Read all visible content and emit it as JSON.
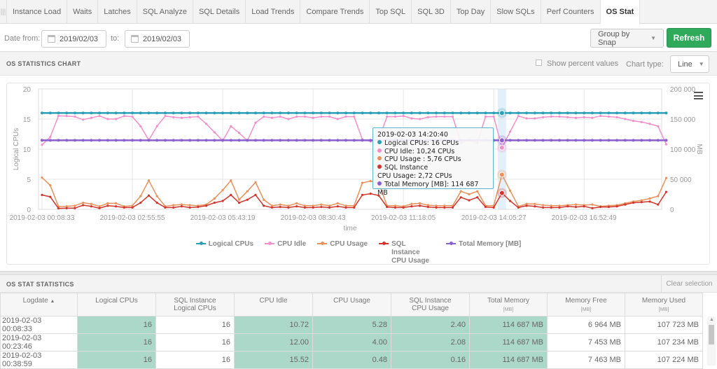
{
  "tabs": [
    {
      "label": "Instance Load",
      "active": false
    },
    {
      "label": "Waits",
      "active": false
    },
    {
      "label": "Latches",
      "active": false
    },
    {
      "label": "SQL Analyze",
      "active": false
    },
    {
      "label": "SQL Details",
      "active": false
    },
    {
      "label": "Load Trends",
      "active": false
    },
    {
      "label": "Compare Trends",
      "active": false
    },
    {
      "label": "Top SQL",
      "active": false
    },
    {
      "label": "SQL 3D",
      "active": false
    },
    {
      "label": "Top Day",
      "active": false
    },
    {
      "label": "Slow SQLs",
      "active": false
    },
    {
      "label": "Perf Counters",
      "active": false
    },
    {
      "label": "OS Stat",
      "active": true
    }
  ],
  "toolbar": {
    "date_from_label": "Date from:",
    "date_from": "2019/02/03",
    "to_label": "to:",
    "date_to": "2019/02/03",
    "group_by": "Group by Snap",
    "refresh_label": "Refresh"
  },
  "chart_panel": {
    "title": "OS STATISTICS CHART",
    "show_percent_label": "Show percent values",
    "show_percent_checked": false,
    "chart_type_label": "Chart type:",
    "chart_type": "Line",
    "menu_icon": "hamburger-menu-icon"
  },
  "tooltip": {
    "time": "2019-02-03 14:20:40",
    "lines": [
      {
        "text": "Logical CPUs: 16 CPUs",
        "color": "#2a9fb5"
      },
      {
        "text": "CPU Idle: 10,24 CPUs",
        "color": "#f28fc9"
      },
      {
        "text": "CPU Usage : 5,76 CPUs",
        "color": "#e8915a"
      },
      {
        "text": "SQL Instance",
        "color": "#d0342c"
      },
      {
        "text": "CPU Usage: 2,72 CPUs",
        "color": null
      },
      {
        "text": "Total Memory [MB]: 114 687 MB",
        "color": "#8a5fd0"
      }
    ]
  },
  "chart_data": {
    "type": "line",
    "title": "",
    "xlabel": "time",
    "ylabel": "Logical CPUs",
    "y2label": "MB",
    "ylim": [
      0,
      20
    ],
    "y2lim": [
      0,
      200000
    ],
    "yticks": [
      "0",
      "5",
      "10",
      "15",
      "20"
    ],
    "y2ticks": [
      "0",
      "50 000",
      "100 000",
      "150 000",
      "200 000"
    ],
    "xtick_labels": [
      "2019-02-03 00:08:33",
      "2019-02-03 02:55:55",
      "2019-02-03 05:43:19",
      "2019-02-03 08:30:43",
      "2019-02-03 11:18:05",
      "2019-02-03 14:05:27",
      "2019-02-03 16:52:49"
    ],
    "xtick_index": [
      0,
      11,
      22,
      33,
      44,
      55,
      66
    ],
    "highlight_index": 56,
    "grid": true,
    "legend_position": "bottom",
    "series": [
      {
        "name": "Logical CPUs",
        "color": "#2a9fb5",
        "axis": "left",
        "constant": 16
      },
      {
        "name": "CPU Idle",
        "color": "#f28fc9",
        "axis": "left",
        "values": [
          10.72,
          12.0,
          15.52,
          15.5,
          15.4,
          14.9,
          15.2,
          15.5,
          15.0,
          15.0,
          15.5,
          15.4,
          13.8,
          11.5,
          13.8,
          15.5,
          15.3,
          15.2,
          15.3,
          15.4,
          14.2,
          12.8,
          11.4,
          13.8,
          12.7,
          11.4,
          14.4,
          15.4,
          15.2,
          15.4,
          15.0,
          15.4,
          15.4,
          15.2,
          15.4,
          15.4,
          15.0,
          15.4,
          15.4,
          11.6,
          11.3,
          11.6,
          15.4,
          15.4,
          15.5,
          15.1,
          15.0,
          15.3,
          15.4,
          15.4,
          15.4,
          11.0,
          11.5,
          11.0,
          15.4,
          15.4,
          10.24,
          12.9,
          15.5,
          15.1,
          15.1,
          15.3,
          15.4,
          15.4,
          15.3,
          15.2,
          15.3,
          15.2,
          15.5,
          15.4,
          15.3,
          15.0,
          14.7,
          14.5,
          14.2,
          13.8,
          10.8
        ]
      },
      {
        "name": "CPU Usage",
        "color": "#e8915a",
        "axis": "left",
        "values": [
          5.28,
          4.0,
          0.48,
          0.5,
          0.6,
          1.1,
          0.9,
          0.5,
          1.0,
          1.0,
          0.5,
          0.6,
          2.2,
          4.8,
          2.2,
          0.5,
          0.7,
          0.8,
          0.7,
          0.6,
          0.8,
          1.8,
          3.2,
          4.8,
          1.6,
          3.0,
          4.5,
          1.6,
          0.6,
          0.8,
          0.6,
          1.0,
          0.6,
          0.6,
          0.8,
          0.6,
          1.0,
          0.6,
          0.6,
          4.4,
          4.7,
          4.4,
          0.6,
          0.6,
          0.5,
          0.9,
          1.0,
          0.7,
          0.6,
          0.6,
          0.6,
          3.0,
          2.5,
          3.0,
          0.6,
          0.6,
          5.76,
          3.1,
          0.5,
          0.9,
          0.9,
          0.7,
          0.6,
          0.6,
          0.7,
          0.8,
          0.7,
          0.8,
          0.5,
          0.6,
          0.7,
          1.0,
          1.3,
          1.5,
          1.8,
          2.2,
          5.2
        ]
      },
      {
        "name": "SQL Instance CPU Usage",
        "color": "#d0342c",
        "axis": "left",
        "values": [
          2.4,
          2.08,
          0.16,
          0.2,
          0.2,
          0.7,
          0.5,
          0.2,
          0.6,
          0.5,
          0.3,
          0.3,
          1.1,
          2.3,
          1.1,
          0.3,
          0.3,
          0.5,
          0.3,
          0.4,
          0.6,
          1.1,
          1.4,
          2.4,
          1.1,
          1.6,
          2.4,
          0.6,
          0.3,
          0.4,
          0.3,
          0.5,
          0.3,
          0.3,
          0.4,
          0.3,
          0.5,
          0.3,
          0.3,
          2.4,
          2.6,
          2.3,
          0.4,
          0.3,
          0.3,
          0.5,
          0.6,
          0.4,
          0.3,
          0.3,
          0.3,
          2.0,
          1.5,
          2.0,
          0.4,
          0.3,
          2.72,
          1.4,
          0.3,
          0.6,
          0.5,
          0.3,
          0.3,
          0.3,
          0.5,
          0.4,
          0.5,
          0.2,
          0.4,
          0.4,
          0.5,
          0.8,
          1.1,
          1.2,
          1.3,
          0.8,
          2.9
        ]
      },
      {
        "name": "Total Memory [MB]",
        "color": "#8a5fd0",
        "axis": "right",
        "constant": 114687
      }
    ]
  },
  "legend": [
    {
      "label": "Logical CPUs",
      "color": "#2a9fb5"
    },
    {
      "label": "CPU Idle",
      "color": "#f28fc9"
    },
    {
      "label": "CPU Usage",
      "color": "#e8915a"
    },
    {
      "label": "SQL Instance CPU Usage",
      "color": "#d0342c"
    },
    {
      "label": "Total Memory [MB]",
      "color": "#8a5fd0"
    }
  ],
  "stats_panel": {
    "title": "OS STAT STATISTICS",
    "clear_selection": "Clear selection",
    "columns": [
      {
        "label": "Logdate",
        "sub": "",
        "unit": "",
        "sort": "▲"
      },
      {
        "label": "Logical CPUs",
        "sub": "",
        "unit": ""
      },
      {
        "label": "SQL Instance",
        "sub": "Logical CPUs",
        "unit": ""
      },
      {
        "label": "CPU Idle",
        "sub": "",
        "unit": ""
      },
      {
        "label": "CPU Usage",
        "sub": "",
        "unit": ""
      },
      {
        "label": "SQL Instance",
        "sub": "CPU Usage",
        "unit": ""
      },
      {
        "label": "Total Memory",
        "sub": "",
        "unit": "[MB]"
      },
      {
        "label": "Memory Free",
        "sub": "",
        "unit": "[MB]"
      },
      {
        "label": "Memory Used",
        "sub": "",
        "unit": "[MB]"
      }
    ],
    "rows": [
      [
        "2019-02-03 00:08:33",
        "16",
        "16",
        "10.72",
        "5.28",
        "2.40",
        "114 687 MB",
        "6 964 MB",
        "107 723 MB"
      ],
      [
        "2019-02-03 00:23:46",
        "16",
        "16",
        "12.00",
        "4.00",
        "2.08",
        "114 687 MB",
        "7 453 MB",
        "107 234 MB"
      ],
      [
        "2019-02-03 00:38:59",
        "16",
        "16",
        "15.52",
        "0.48",
        "0.16",
        "114 687 MB",
        "7 463 MB",
        "107 224 MB"
      ]
    ]
  }
}
